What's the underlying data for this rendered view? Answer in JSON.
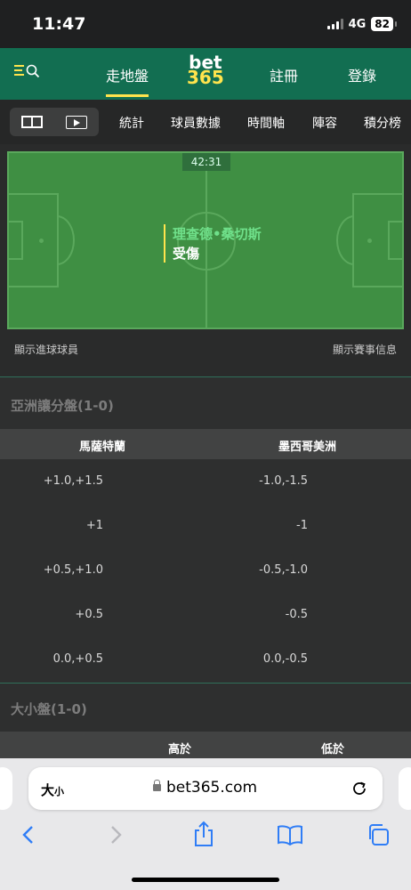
{
  "status_bar": {
    "time": "11:47",
    "network": "4G",
    "battery": "82"
  },
  "header": {
    "nav_live": "走地盤",
    "logo_top": "bet",
    "logo_bottom": "365",
    "register": "註冊",
    "login": "登錄",
    "active_color": "#ffe44d",
    "brand_color": "#126e51"
  },
  "tabs": [
    "統計",
    "球員數據",
    "時間軸",
    "陣容",
    "積分榜"
  ],
  "pitch": {
    "clock": "42:31",
    "event_player": "理查德•桑切斯",
    "event_desc": "受傷",
    "show_scorers": "顯示進球球員",
    "show_match_info": "顯示賽事信息"
  },
  "asian_handicap": {
    "title": "亞洲讓分盤(1-0)",
    "home": "馬薩特蘭",
    "away": "墨西哥美洲",
    "rows": [
      {
        "home": "+1.0,+1.5",
        "away": "-1.0,-1.5"
      },
      {
        "home": "+1",
        "away": "-1"
      },
      {
        "home": "+0.5,+1.0",
        "away": "-0.5,-1.0"
      },
      {
        "home": "+0.5",
        "away": "-0.5"
      },
      {
        "home": "0.0,+0.5",
        "away": "0.0,-0.5"
      }
    ]
  },
  "totals": {
    "title": "大小盤(1-0)",
    "over": "高於",
    "under": "低於"
  },
  "browser": {
    "text_size": "大",
    "text_size_small": "小",
    "url": "bet365.com",
    "icons": [
      "back-icon",
      "forward-icon",
      "share-icon",
      "bookmarks-icon",
      "tabs-icon"
    ]
  }
}
